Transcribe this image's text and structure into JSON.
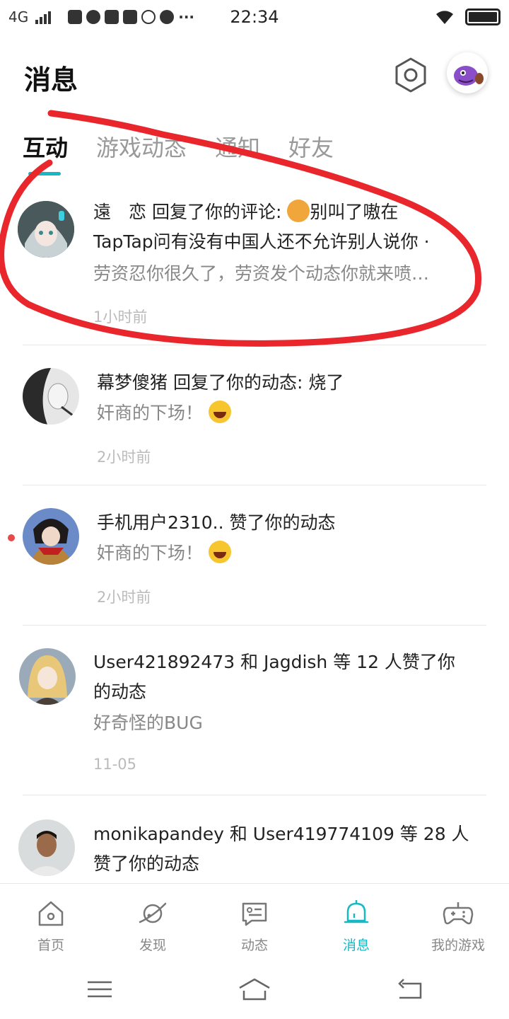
{
  "status_bar": {
    "network": "4G",
    "time": "22:34",
    "dots": "···"
  },
  "header": {
    "title": "消息"
  },
  "tabs": [
    {
      "label": "互动",
      "active": true
    },
    {
      "label": "游戏动态",
      "active": false
    },
    {
      "label": "通知",
      "active": false
    },
    {
      "label": "好友",
      "active": false
    }
  ],
  "messages": [
    {
      "line1": "遠　恋 回复了你的评论: ",
      "line1_after_emoji": "别叫了嗷在",
      "line1_emoji": "dog-emoji",
      "line1b": "TapTap问有没有中国人还不允许别人说你 ·",
      "line2": "劳资忍你很久了，劳资发个动态你就来喷…",
      "time": "1小时前",
      "unread": false
    },
    {
      "line1": "幕梦傻猪 回复了你的动态: 烧了",
      "line2": "奸商的下场！",
      "line2_emoji": "laughing-emoji",
      "time": "2小时前",
      "unread": false
    },
    {
      "line1": "手机用户2310.. 赞了你的动态",
      "line2": "奸商的下场！",
      "line2_emoji": "laughing-emoji",
      "time": "2小时前",
      "unread": true
    },
    {
      "line1": "User421892473 和 Jagdish 等 12 人赞了你",
      "line1b": "的动态",
      "line2": "好奇怪的BUG",
      "time": "11-05",
      "unread": false
    },
    {
      "line1": "monikapandey 和 User419774109 等 28 人",
      "line1b": "赞了你的动态",
      "unread": false
    }
  ],
  "bottom_nav": [
    {
      "label": "首页",
      "icon": "home-icon",
      "active": false
    },
    {
      "label": "发现",
      "icon": "planet-icon",
      "active": false
    },
    {
      "label": "动态",
      "icon": "feed-icon",
      "active": false
    },
    {
      "label": "消息",
      "icon": "bell-icon",
      "active": true
    },
    {
      "label": "我的游戏",
      "icon": "gamepad-icon",
      "active": false
    }
  ],
  "colors": {
    "accent": "#17b8c4",
    "annotation": "#e8262b",
    "unread": "#e84a4a"
  }
}
